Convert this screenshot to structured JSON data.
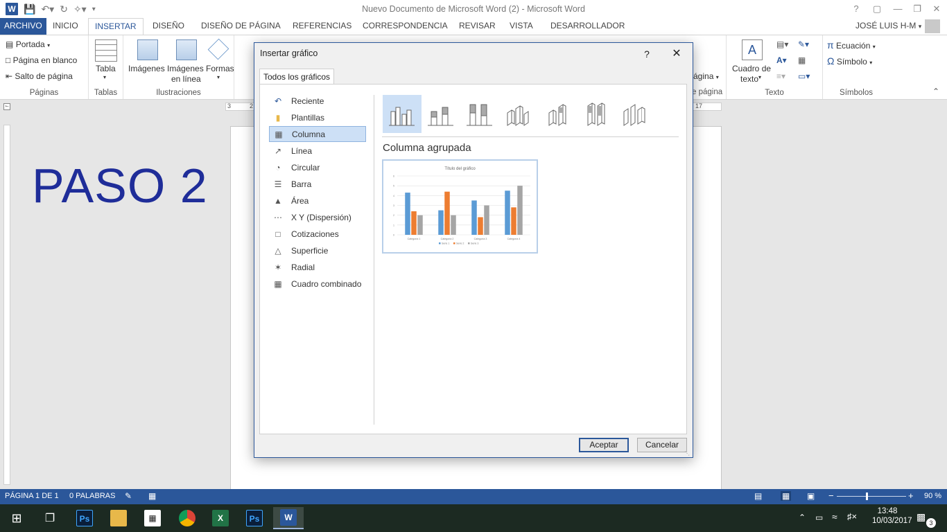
{
  "window": {
    "title": "Nuevo Documento de Microsoft Word (2) - Microsoft Word",
    "help": "?"
  },
  "ribbon": {
    "tabs": [
      "ARCHIVO",
      "INICIO",
      "INSERTAR",
      "DISEÑO",
      "DISEÑO DE PÁGINA",
      "REFERENCIAS",
      "CORRESPONDENCIA",
      "REVISAR",
      "VISTA",
      "DESARROLLADOR"
    ],
    "active_tab": "INSERTAR",
    "user": "JOSÉ LUIS H-M",
    "paginas": {
      "portada": "Portada",
      "blanco": "Página en blanco",
      "salto": "Salto de página",
      "label": "Páginas"
    },
    "tablas": {
      "tabla": "Tabla",
      "label": "Tablas"
    },
    "ilustraciones": {
      "imagenes": "Imágenes",
      "imagenes_linea_1": "Imágenes",
      "imagenes_linea_2": "en línea",
      "formas": "Formas",
      "label": "Ilustraciones"
    },
    "pagina_partial": "ágina",
    "pagina_label_partial": "e página",
    "texto": {
      "cuadro_1": "Cuadro de",
      "cuadro_2": "texto",
      "label": "Texto"
    },
    "simbolos": {
      "ecuacion": "Ecuación",
      "simbolo": "Símbolo",
      "label": "Símbolos"
    }
  },
  "document": {
    "text": "PASO 2"
  },
  "ruler": {
    "h_left": "3",
    "h_left2": "2",
    "h_right": "17"
  },
  "dialog": {
    "title": "Insertar gráfico",
    "tab": "Todos los gráficos",
    "categories": [
      {
        "label": "Reciente",
        "icon": "recent-icon"
      },
      {
        "label": "Plantillas",
        "icon": "folder-icon"
      },
      {
        "label": "Columna",
        "icon": "column-chart-icon"
      },
      {
        "label": "Línea",
        "icon": "line-chart-icon"
      },
      {
        "label": "Circular",
        "icon": "pie-chart-icon"
      },
      {
        "label": "Barra",
        "icon": "bar-chart-icon"
      },
      {
        "label": "Área",
        "icon": "area-chart-icon"
      },
      {
        "label": "X Y (Dispersión)",
        "icon": "scatter-chart-icon"
      },
      {
        "label": "Cotizaciones",
        "icon": "stock-chart-icon"
      },
      {
        "label": "Superficie",
        "icon": "surface-chart-icon"
      },
      {
        "label": "Radial",
        "icon": "radar-chart-icon"
      },
      {
        "label": "Cuadro combinado",
        "icon": "combo-chart-icon"
      }
    ],
    "selected_category": "Columna",
    "selected_type": "Columna agrupada",
    "preview": {
      "title": "Título del gráfico",
      "categories": [
        "Categoría 1",
        "Categoría 2",
        "Categoría 3",
        "Categoría 4"
      ],
      "series": [
        "Serie 1",
        "Serie 2",
        "Serie 3"
      ],
      "colors": [
        "#5b9bd5",
        "#ed7d31",
        "#a5a5a5"
      ]
    },
    "ok": "Aceptar",
    "cancel": "Cancelar"
  },
  "status": {
    "page": "PÁGINA 1 DE 1",
    "words": "0 PALABRAS",
    "zoom": "90 %"
  },
  "taskbar": {
    "time": "13:48",
    "date": "10/03/2017",
    "notifications": "3"
  },
  "chart_data": {
    "type": "bar",
    "title": "Título del gráfico",
    "categories": [
      "Categoría 1",
      "Categoría 2",
      "Categoría 3",
      "Categoría 4"
    ],
    "series": [
      {
        "name": "Serie 1",
        "values": [
          4.3,
          2.5,
          3.5,
          4.5
        ]
      },
      {
        "name": "Serie 2",
        "values": [
          2.4,
          4.4,
          1.8,
          2.8
        ]
      },
      {
        "name": "Serie 3",
        "values": [
          2,
          2,
          3,
          5
        ]
      }
    ],
    "ylim": [
      0,
      6
    ],
    "grid": true,
    "legend": "bottom"
  }
}
